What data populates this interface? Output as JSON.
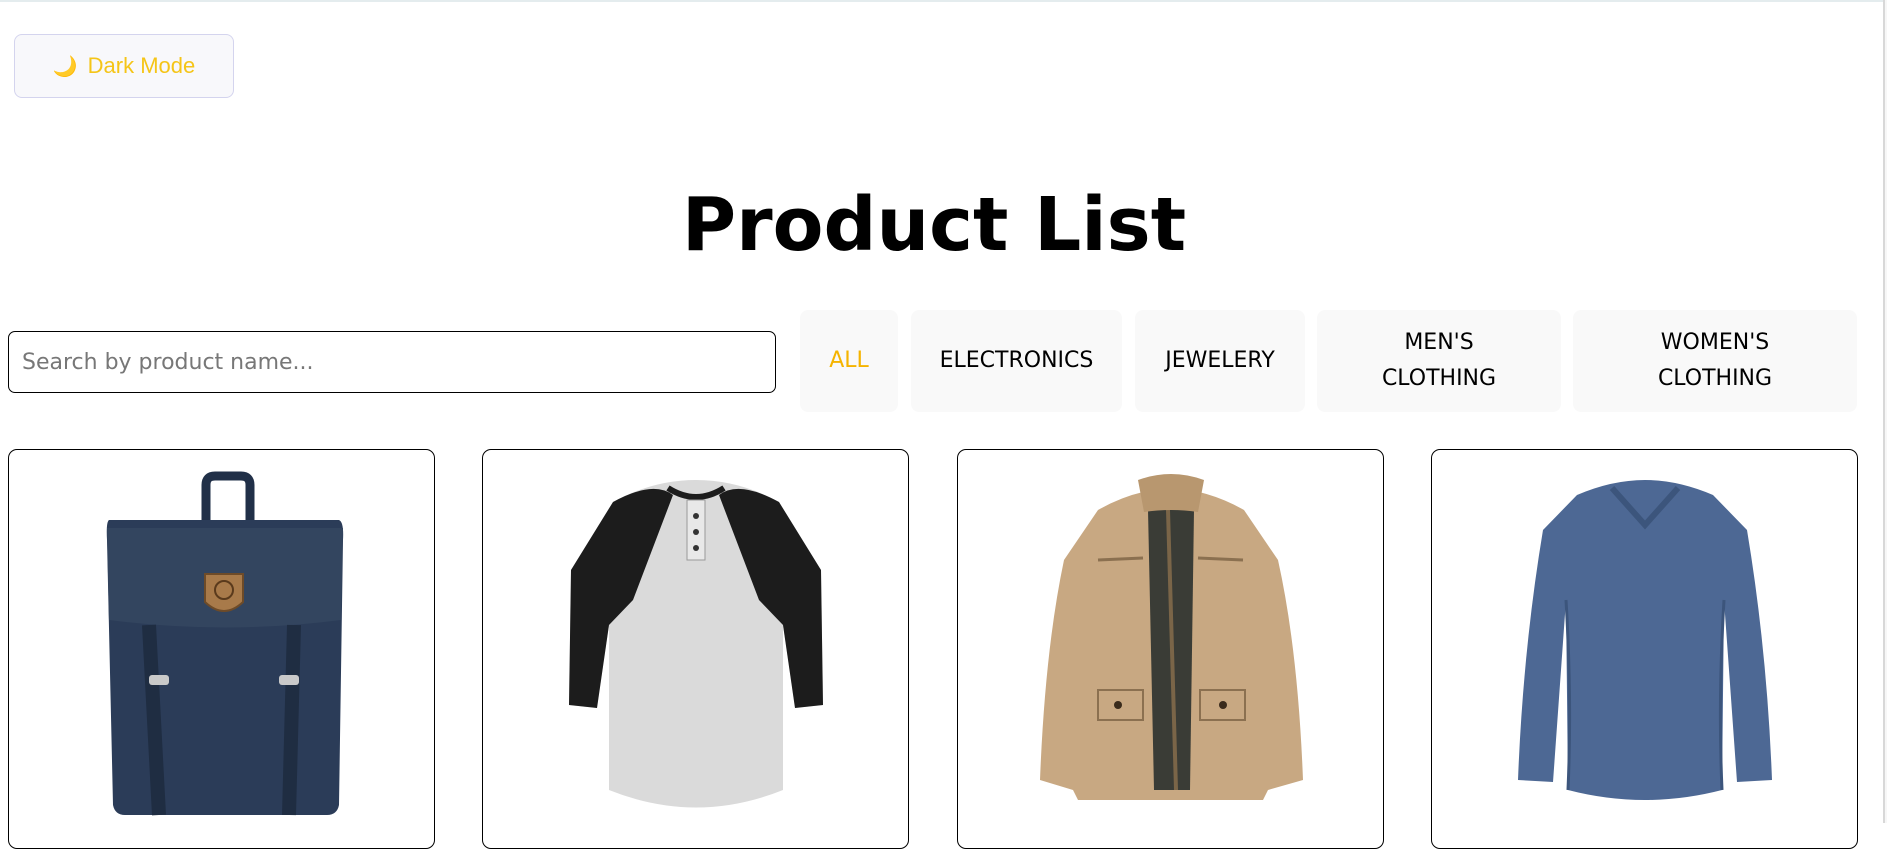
{
  "theme_toggle": {
    "icon": "moon-icon",
    "glyph": "🌙",
    "label": "Dark Mode"
  },
  "page_title": "Product List",
  "search": {
    "placeholder": "Search by product name...",
    "value": ""
  },
  "categories": [
    {
      "label": "ALL",
      "active": true
    },
    {
      "label": "ELECTRONICS",
      "active": false
    },
    {
      "label": "JEWELERY",
      "active": false
    },
    {
      "label": "MEN'S\nCLOTHING",
      "active": false
    },
    {
      "label": "WOMEN'S\nCLOTHING",
      "active": false
    }
  ],
  "products": [
    {
      "image": "backpack-image"
    },
    {
      "image": "raglan-tshirt-image"
    },
    {
      "image": "khaki-jacket-image"
    },
    {
      "image": "blue-long-sleeve-shirt-image"
    }
  ],
  "colors": {
    "accent": "#f5b400",
    "button_text": "#f5c518",
    "category_bg": "#f9f9f9"
  }
}
